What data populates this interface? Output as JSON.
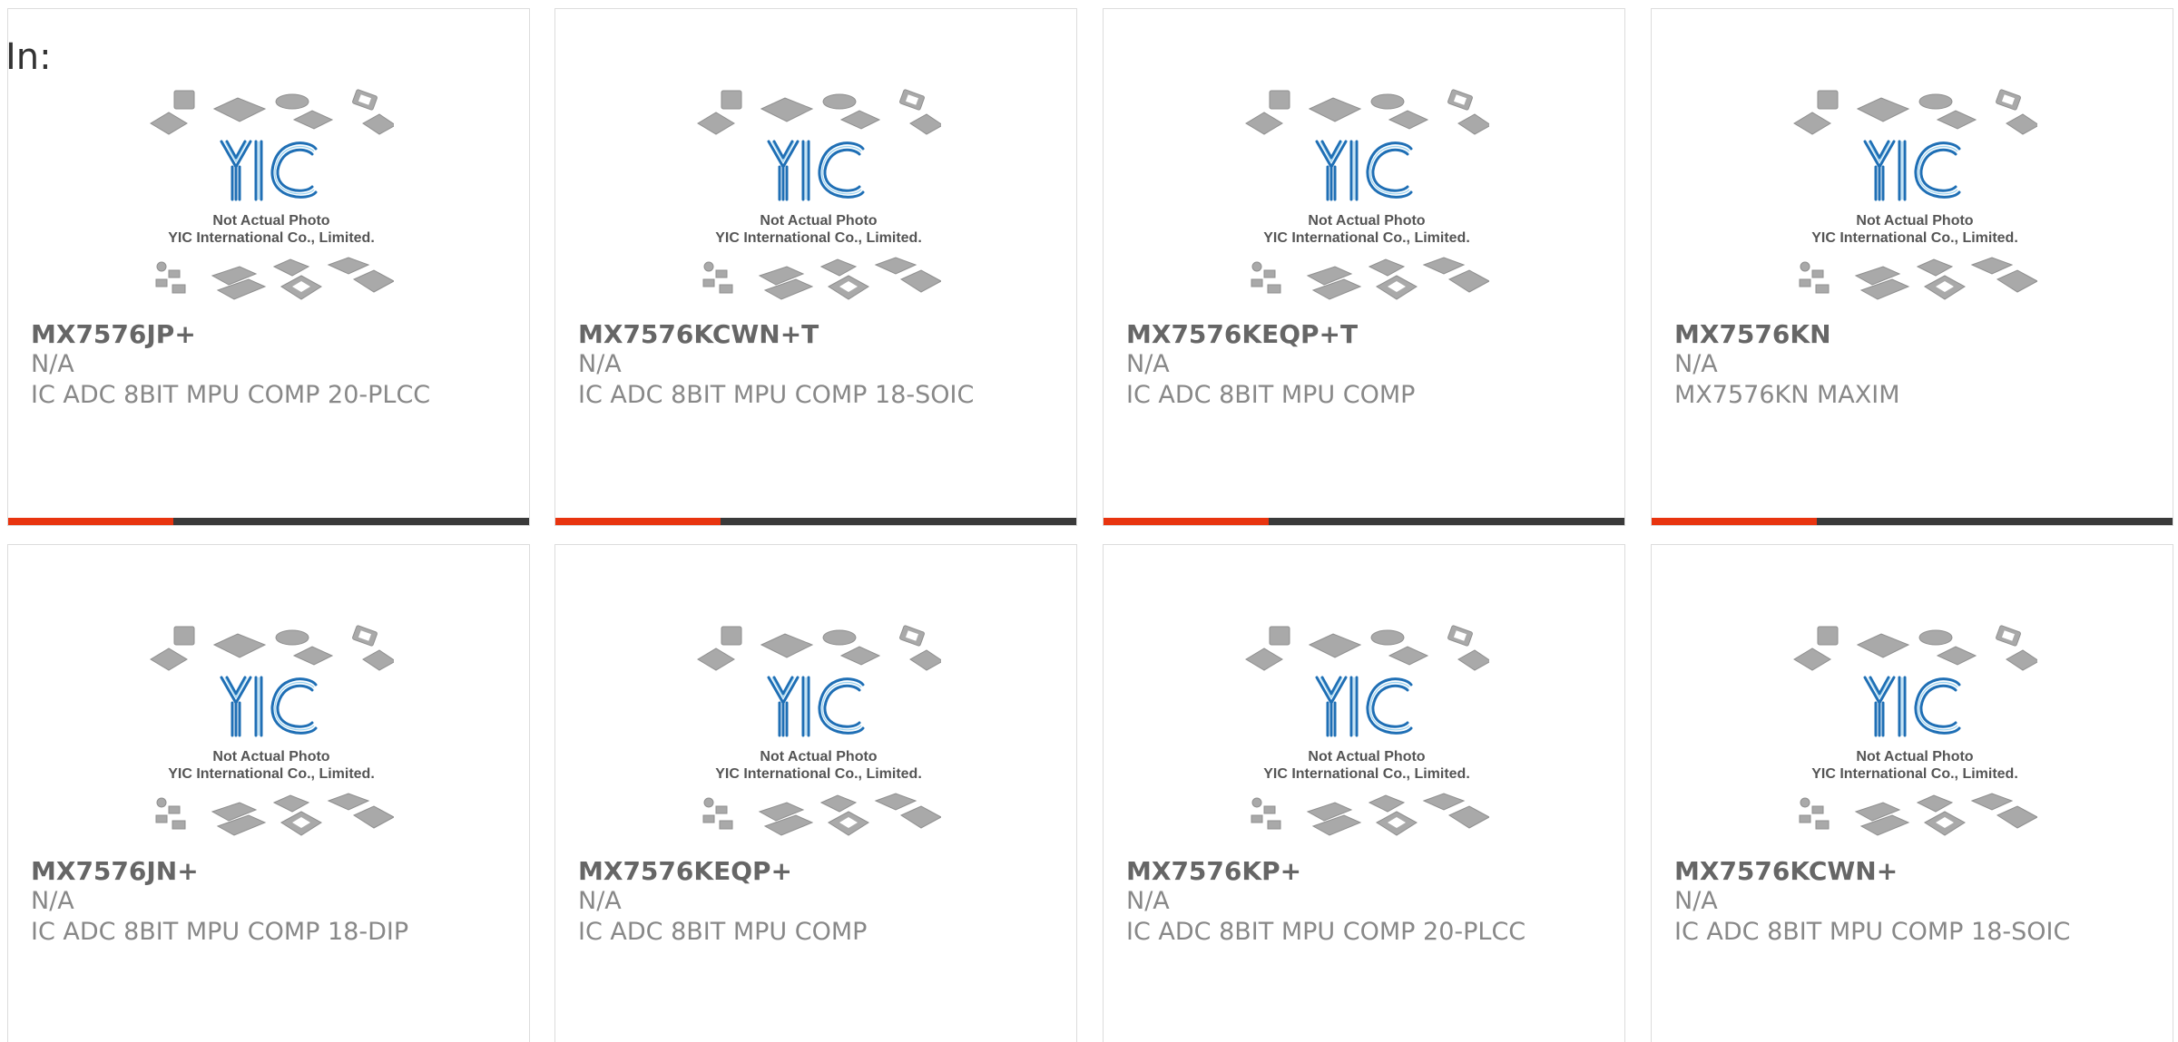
{
  "header": {
    "label": "In:"
  },
  "placeholder_photo": {
    "line1": "Not Actual Photo",
    "line2": "YIC International Co., Limited.",
    "logo_text": "YIC"
  },
  "colors": {
    "accent": "#e8340f",
    "bar": "#3a3a3a",
    "logo_blue": "#1f6fb5"
  },
  "products": [
    {
      "part_number": "MX7576JP+",
      "manufacturer": "N/A",
      "description": "IC ADC 8BIT MPU COMP 20-PLCC"
    },
    {
      "part_number": "MX7576KCWN+T",
      "manufacturer": "N/A",
      "description": "IC ADC 8BIT MPU COMP 18-SOIC"
    },
    {
      "part_number": "MX7576KEQP+T",
      "manufacturer": "N/A",
      "description": "IC ADC 8BIT MPU COMP"
    },
    {
      "part_number": "MX7576KN",
      "manufacturer": "N/A",
      "description": "MX7576KN MAXIM"
    },
    {
      "part_number": "MX7576JN+",
      "manufacturer": "N/A",
      "description": "IC ADC 8BIT MPU COMP 18-DIP"
    },
    {
      "part_number": "MX7576KEQP+",
      "manufacturer": "N/A",
      "description": "IC ADC 8BIT MPU COMP"
    },
    {
      "part_number": "MX7576KP+",
      "manufacturer": "N/A",
      "description": "IC ADC 8BIT MPU COMP 20-PLCC"
    },
    {
      "part_number": "MX7576KCWN+",
      "manufacturer": "N/A",
      "description": "IC ADC 8BIT MPU COMP 18-SOIC"
    }
  ]
}
